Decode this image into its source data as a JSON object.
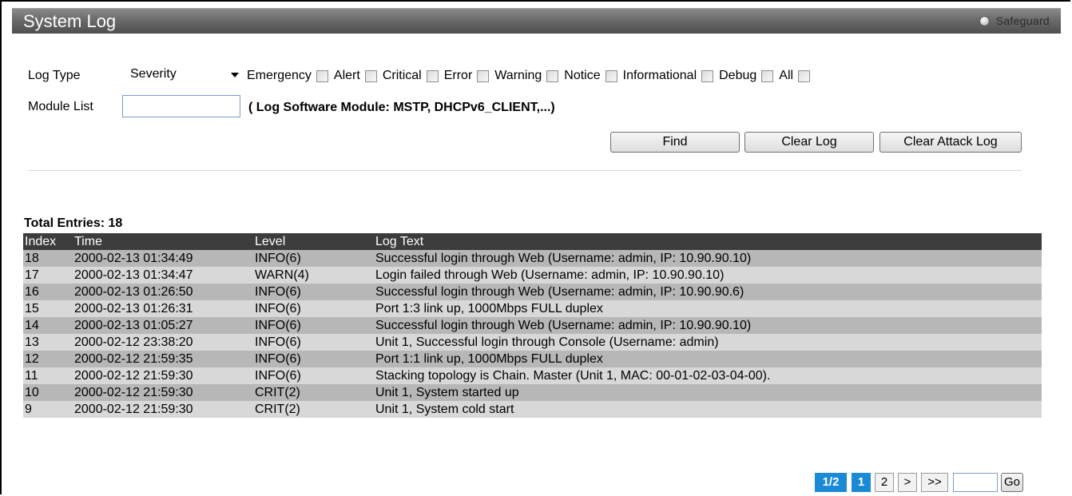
{
  "header": {
    "title": "System Log",
    "safeguard_label": "Safeguard"
  },
  "form": {
    "log_type_label": "Log Type",
    "log_type_value": "Severity",
    "severities": [
      "Emergency",
      "Alert",
      "Critical",
      "Error",
      "Warning",
      "Notice",
      "Informational",
      "Debug",
      "All"
    ],
    "module_list_label": "Module List",
    "module_list_value": "",
    "module_hint": "( Log Software Module: MSTP, DHCPv6_CLIENT,...)",
    "find_label": "Find",
    "clear_log_label": "Clear Log",
    "clear_attack_log_label": "Clear Attack Log"
  },
  "log": {
    "total_label": "Total Entries: 18",
    "columns": [
      "Index",
      "Time",
      "Level",
      "Log Text"
    ],
    "rows": [
      [
        "18",
        "2000-02-13 01:34:49",
        "INFO(6)",
        "Successful login through Web (Username: admin, IP: 10.90.90.10)"
      ],
      [
        "17",
        "2000-02-13 01:34:47",
        "WARN(4)",
        "Login failed through Web (Username: admin, IP: 10.90.90.10)"
      ],
      [
        "16",
        "2000-02-13 01:26:50",
        "INFO(6)",
        "Successful login through Web (Username: admin, IP: 10.90.90.6)"
      ],
      [
        "15",
        "2000-02-13 01:26:31",
        "INFO(6)",
        "Port 1:3 link up, 1000Mbps FULL duplex"
      ],
      [
        "14",
        "2000-02-13 01:05:27",
        "INFO(6)",
        "Successful login through Web (Username: admin, IP: 10.90.90.10)"
      ],
      [
        "13",
        "2000-02-12 23:38:20",
        "INFO(6)",
        "Unit 1, Successful login through Console (Username: admin)"
      ],
      [
        "12",
        "2000-02-12 21:59:35",
        "INFO(6)",
        "Port 1:1 link up, 1000Mbps FULL duplex"
      ],
      [
        "11",
        "2000-02-12 21:59:30",
        "INFO(6)",
        "Stacking topology is Chain. Master (Unit 1, MAC: 00-01-02-03-04-00)."
      ],
      [
        "10",
        "2000-02-12 21:59:30",
        "CRIT(2)",
        "Unit 1, System started up"
      ],
      [
        "9",
        "2000-02-12 21:59:30",
        "CRIT(2)",
        "Unit 1, System cold start"
      ]
    ]
  },
  "pager": {
    "page_indicator": "1/2",
    "pages": [
      "1",
      "2"
    ],
    "next_label": ">",
    "last_label": ">>",
    "go_label": "Go",
    "go_value": ""
  },
  "colors": {
    "header_bg": "#3c3c3c",
    "row_odd": "#b7b7b7",
    "row_even": "#d8d8d8",
    "pager_active": "#1a8ad6"
  }
}
